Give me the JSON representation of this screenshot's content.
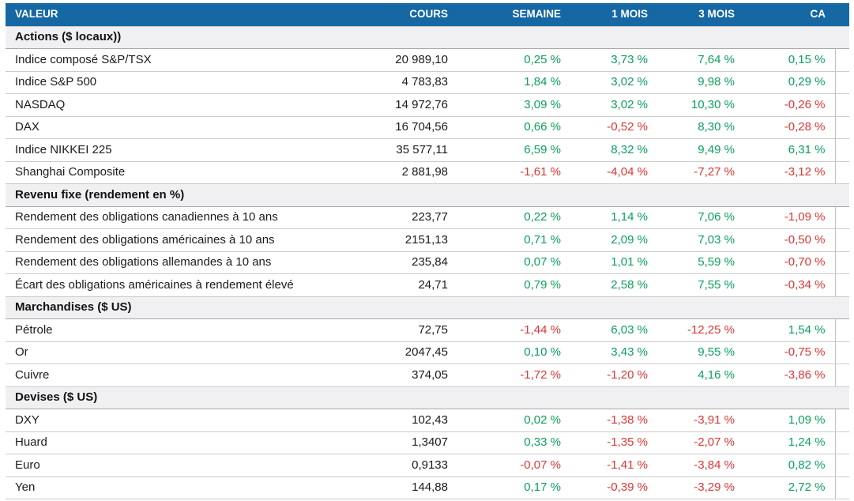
{
  "colors": {
    "header_bg": "#1568A4",
    "header_text": "#FFFFFF",
    "section_bg": "#F0F0F2",
    "positive": "#0CA05C",
    "negative": "#E03535",
    "row_border": "#CBCBCB",
    "text": "#1B1B1B"
  },
  "chart_data": {
    "type": "table",
    "columns": [
      "VALEUR",
      "COURS",
      "SEMAINE",
      "1 MOIS",
      "3 MOIS",
      "CA"
    ],
    "sections": [
      {
        "title": "Actions ($ locaux))",
        "rows": [
          {
            "label": "Indice composé S&P/TSX",
            "cours": "20 989,10",
            "pct": [
              {
                "v": "0,25 %",
                "c": "pos"
              },
              {
                "v": "3,73 %",
                "c": "pos"
              },
              {
                "v": "7,64 %",
                "c": "pos"
              },
              {
                "v": "0,15 %",
                "c": "pos"
              }
            ]
          },
          {
            "label": "Indice S&P 500",
            "cours": "4 783,83",
            "pct": [
              {
                "v": "1,84 %",
                "c": "pos"
              },
              {
                "v": "3,02 %",
                "c": "pos"
              },
              {
                "v": "9,98 %",
                "c": "pos"
              },
              {
                "v": "0,29 %",
                "c": "pos"
              }
            ]
          },
          {
            "label": "NASDAQ",
            "cours": "14 972,76",
            "pct": [
              {
                "v": "3,09 %",
                "c": "pos"
              },
              {
                "v": "3,02 %",
                "c": "pos"
              },
              {
                "v": "10,30 %",
                "c": "pos"
              },
              {
                "v": "-0,26 %",
                "c": "neg"
              }
            ]
          },
          {
            "label": "DAX",
            "cours": "16 704,56",
            "pct": [
              {
                "v": "0,66 %",
                "c": "pos"
              },
              {
                "v": "-0,52 %",
                "c": "neg"
              },
              {
                "v": "8,30 %",
                "c": "pos"
              },
              {
                "v": "-0,28 %",
                "c": "neg"
              }
            ]
          },
          {
            "label": "Indice NIKKEI 225",
            "cours": "35 577,11",
            "pct": [
              {
                "v": "6,59 %",
                "c": "pos"
              },
              {
                "v": "8,32 %",
                "c": "pos"
              },
              {
                "v": "9,49 %",
                "c": "pos"
              },
              {
                "v": "6,31 %",
                "c": "pos"
              }
            ]
          },
          {
            "label": "Shanghai Composite",
            "cours": "2 881,98",
            "pct": [
              {
                "v": "-1,61 %",
                "c": "neg"
              },
              {
                "v": "-4,04 %",
                "c": "neg"
              },
              {
                "v": "-7,27 %",
                "c": "neg"
              },
              {
                "v": "-3,12 %",
                "c": "neg"
              }
            ]
          }
        ]
      },
      {
        "title": "Revenu fixe (rendement en %)",
        "rows": [
          {
            "label": "Rendement des obligations canadiennes à 10 ans",
            "cours": "223,77",
            "pct": [
              {
                "v": "0,22 %",
                "c": "pos"
              },
              {
                "v": "1,14 %",
                "c": "pos"
              },
              {
                "v": "7,06 %",
                "c": "pos"
              },
              {
                "v": "-1,09 %",
                "c": "neg"
              }
            ]
          },
          {
            "label": "Rendement des obligations américaines à 10 ans",
            "cours": "2151,13",
            "pct": [
              {
                "v": "0,71 %",
                "c": "pos"
              },
              {
                "v": "2,09 %",
                "c": "pos"
              },
              {
                "v": "7,03 %",
                "c": "pos"
              },
              {
                "v": "-0,50 %",
                "c": "neg"
              }
            ]
          },
          {
            "label": "Rendement des obligations allemandes à 10 ans",
            "cours": "235,84",
            "pct": [
              {
                "v": "0,07 %",
                "c": "pos"
              },
              {
                "v": "1,01 %",
                "c": "pos"
              },
              {
                "v": "5,59 %",
                "c": "pos"
              },
              {
                "v": "-0,70 %",
                "c": "neg"
              }
            ]
          },
          {
            "label": "Écart des obligations américaines à rendement élevé",
            "cours": "24,71",
            "pct": [
              {
                "v": "0,79 %",
                "c": "pos"
              },
              {
                "v": "2,58 %",
                "c": "pos"
              },
              {
                "v": "7,55 %",
                "c": "pos"
              },
              {
                "v": "-0,34 %",
                "c": "neg"
              }
            ]
          }
        ]
      },
      {
        "title": "Marchandises ($ US)",
        "rows": [
          {
            "label": "Pétrole",
            "cours": "72,75",
            "pct": [
              {
                "v": "-1,44 %",
                "c": "neg"
              },
              {
                "v": "6,03 %",
                "c": "pos"
              },
              {
                "v": "-12,25 %",
                "c": "neg"
              },
              {
                "v": "1,54 %",
                "c": "pos"
              }
            ]
          },
          {
            "label": "Or",
            "cours": "2047,45",
            "pct": [
              {
                "v": "0,10 %",
                "c": "pos"
              },
              {
                "v": "3,43 %",
                "c": "pos"
              },
              {
                "v": "9,55 %",
                "c": "pos"
              },
              {
                "v": "-0,75 %",
                "c": "neg"
              }
            ]
          },
          {
            "label": "Cuivre",
            "cours": "374,05",
            "pct": [
              {
                "v": "-1,72 %",
                "c": "neg"
              },
              {
                "v": "-1,20 %",
                "c": "neg"
              },
              {
                "v": "4,16 %",
                "c": "pos"
              },
              {
                "v": "-3,86 %",
                "c": "neg"
              }
            ]
          }
        ]
      },
      {
        "title": "Devises ($ US)",
        "rows": [
          {
            "label": "DXY",
            "cours": "102,43",
            "pct": [
              {
                "v": "0,02 %",
                "c": "pos"
              },
              {
                "v": "-1,38 %",
                "c": "neg"
              },
              {
                "v": "-3,91 %",
                "c": "neg"
              },
              {
                "v": "1,09 %",
                "c": "pos"
              }
            ]
          },
          {
            "label": "Huard",
            "cours": "1,3407",
            "pct": [
              {
                "v": "0,33 %",
                "c": "pos"
              },
              {
                "v": "-1,35 %",
                "c": "neg"
              },
              {
                "v": "-2,07 %",
                "c": "neg"
              },
              {
                "v": "1,24 %",
                "c": "pos"
              }
            ]
          },
          {
            "label": "Euro",
            "cours": "0,9133",
            "pct": [
              {
                "v": "-0,07 %",
                "c": "neg"
              },
              {
                "v": "-1,41 %",
                "c": "neg"
              },
              {
                "v": "-3,84 %",
                "c": "neg"
              },
              {
                "v": "0,82 %",
                "c": "pos"
              }
            ]
          },
          {
            "label": "Yen",
            "cours": "144,88",
            "pct": [
              {
                "v": "0,17 %",
                "c": "pos"
              },
              {
                "v": "-0,39 %",
                "c": "neg"
              },
              {
                "v": "-3,29 %",
                "c": "neg"
              },
              {
                "v": "2,72 %",
                "c": "pos"
              }
            ]
          }
        ]
      }
    ]
  }
}
